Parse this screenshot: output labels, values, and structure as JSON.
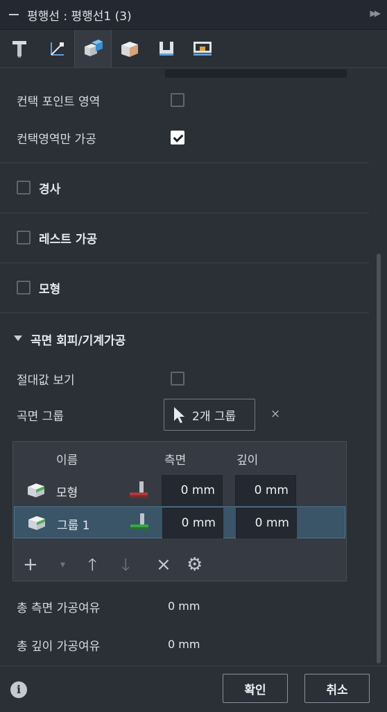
{
  "header": {
    "title": "평행선 : 평행선1 (3)",
    "pin_icon": "double-chevron-right-icon"
  },
  "tabs": [
    {
      "icon": "tool-icon"
    },
    {
      "icon": "axis-icon"
    },
    {
      "icon": "boundary-box-icon"
    },
    {
      "icon": "stock-box-icon"
    },
    {
      "icon": "heights-icon"
    },
    {
      "icon": "passes-icon"
    }
  ],
  "contact": {
    "point_region_label": "컨택 포인트 영역",
    "point_region_checked": false,
    "only_region_label": "컨택영역만 가공",
    "only_region_checked": true
  },
  "sections": {
    "slope_label": "경사",
    "rest_label": "레스트 가공",
    "model_label": "모형",
    "avoid_label": "곡면 회피/기계가공"
  },
  "avoid": {
    "abs_label": "절대값 보기",
    "surface_group_label": "곡면 그룹",
    "group_button_label": "2개 그룹",
    "clear_label": "×"
  },
  "table": {
    "headers": {
      "name": "이름",
      "side": "측면",
      "depth": "깊이"
    },
    "rows": [
      {
        "name": "모형",
        "side": "0 mm",
        "depth": "0 mm"
      },
      {
        "name": "그룹 1",
        "side": "0 mm",
        "depth": "0 mm"
      }
    ],
    "toolbar": {
      "add": "+",
      "dropdown": "▾",
      "up": "🡑",
      "down": "🡓",
      "remove": "×",
      "settings": "⚙"
    }
  },
  "summary": {
    "side_label": "총 측면 가공여유",
    "side_value": "0 mm",
    "depth_label": "총 깊이 가공여유",
    "depth_value": "0 mm"
  },
  "footer": {
    "info": "i",
    "ok_label": "확인",
    "cancel_label": "취소"
  },
  "colors": {
    "accent_selected": "#3a5468",
    "stock_red": "#b03b3b",
    "stock_green": "#3aa64a"
  }
}
